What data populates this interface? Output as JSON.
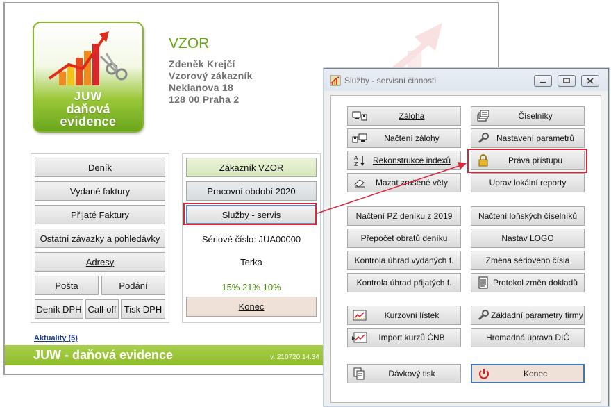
{
  "main": {
    "logo": {
      "line1": "JUW",
      "line2": "daňová",
      "line3": "evidence"
    },
    "company": {
      "name": "VZOR",
      "line1": "Zdeněk Krejčí",
      "line2": "Vzorový zákazník",
      "line3": "Neklanova 18",
      "line4": "128 00 Praha 2"
    },
    "left_buttons": {
      "denik": "Deník",
      "vydane": "Vydané faktury",
      "prijate": "Přijaté Faktury",
      "ostatni": "Ostatní závazky a pohledávky",
      "adresy": "Adresy",
      "posta": "Pošta",
      "podani": "Podání",
      "denik_dph": "Deník DPH",
      "calloff": "Call-off",
      "tisk_dph": "Tisk DPH"
    },
    "right_buttons": {
      "zakaznik": "Zákazník  VZOR",
      "obdobi": "Pracovní období 2020",
      "sluzby": "Služby - servis",
      "konec": "Konec"
    },
    "serial": "Sériové číslo: JUA00000",
    "user": "Terka",
    "percent": "15% 21% 10%",
    "news": "Aktuality (5)",
    "footer_title": "JUW - daňová evidence",
    "version": "v. 210720.14.34"
  },
  "service": {
    "title": "Služby - servisní činnosti",
    "left": {
      "zaloha": "Záloha",
      "nacteni_zalohy": "Načtení zálohy",
      "rekonstrukce": "Rekonstrukce indexů",
      "mazat": "Mazat zrušené věty",
      "nacteni_pz": "Načtení PZ deníku z 2019",
      "prepocet": "Přepočet obratů deníku",
      "kontrola_vyd": "Kontrola úhrad vydaných f.",
      "kontrola_prij": "Kontrola úhrad přijatých f.",
      "kurzovni": "Kurzovní lístek",
      "import_kurzu": "Import kurzů ČNB",
      "davkovy": "Dávkový tisk"
    },
    "right": {
      "ciselniky": "Číselníky",
      "nastaveni": "Nastavení parametrů",
      "prava": "Práva přístupu",
      "uprav": "Uprav lokální reporty",
      "nacteni_lon": "Načtení loňských číselníků",
      "nastav_logo": "Nastav LOGO",
      "zmena": "Změna sériového čísla",
      "protokol": "Protokol změn dokladů",
      "zakladni": "Základní parametry firmy",
      "hromadna": "Hromadná úprava DIČ",
      "konec": "Konec"
    }
  },
  "colors": {
    "accent_green": "#8fbc2a",
    "highlight_red": "#d9263a",
    "selected_blue": "#3d78b8"
  }
}
